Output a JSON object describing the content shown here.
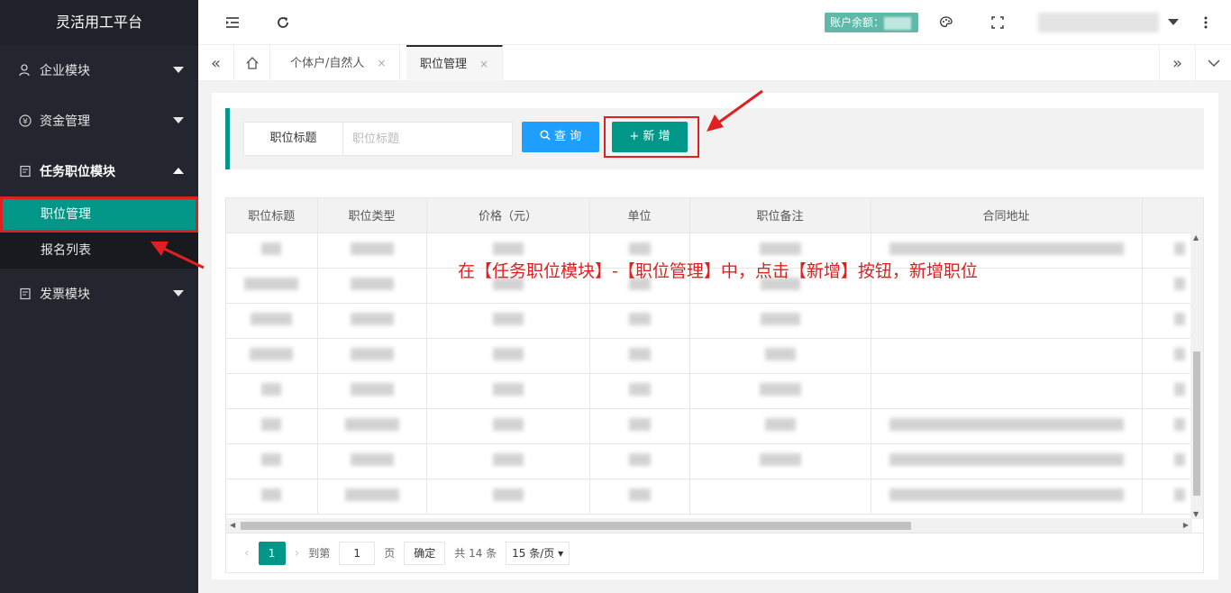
{
  "app": {
    "title": "灵活用工平台"
  },
  "sidebar": {
    "items": [
      {
        "label": "企业模块",
        "icon": "user-lock-icon"
      },
      {
        "label": "资金管理",
        "icon": "yen-icon"
      },
      {
        "label": "任务职位模块",
        "icon": "task-icon"
      },
      {
        "label": "发票模块",
        "icon": "invoice-icon"
      }
    ],
    "sub_items": [
      {
        "label": "职位管理"
      },
      {
        "label": "报名列表"
      }
    ]
  },
  "header": {
    "balance_label": "账户余额："
  },
  "tabs": [
    {
      "label": "个体户/自然人",
      "close": "×"
    },
    {
      "label": "职位管理",
      "close": "×"
    }
  ],
  "search": {
    "label": "职位标题",
    "placeholder": "职位标题",
    "query_button": "查 询",
    "add_button": "+ 新 增"
  },
  "table": {
    "columns": [
      "职位标题",
      "职位类型",
      "价格（元）",
      "单位",
      "职位备注",
      "合同地址"
    ]
  },
  "pagination": {
    "current_page": "1",
    "goto_label": "到第",
    "goto_value": "1",
    "page_unit": "页",
    "confirm": "确定",
    "total": "共 14 条",
    "page_size": "15 条/页"
  },
  "annotation": {
    "text": "在【任务职位模块】-【职位管理】中，点击【新增】按钮，新增职位"
  },
  "colors": {
    "accent": "#009688",
    "query": "#1e9fff",
    "sidebar": "#23262e",
    "annotation": "#e02020"
  }
}
